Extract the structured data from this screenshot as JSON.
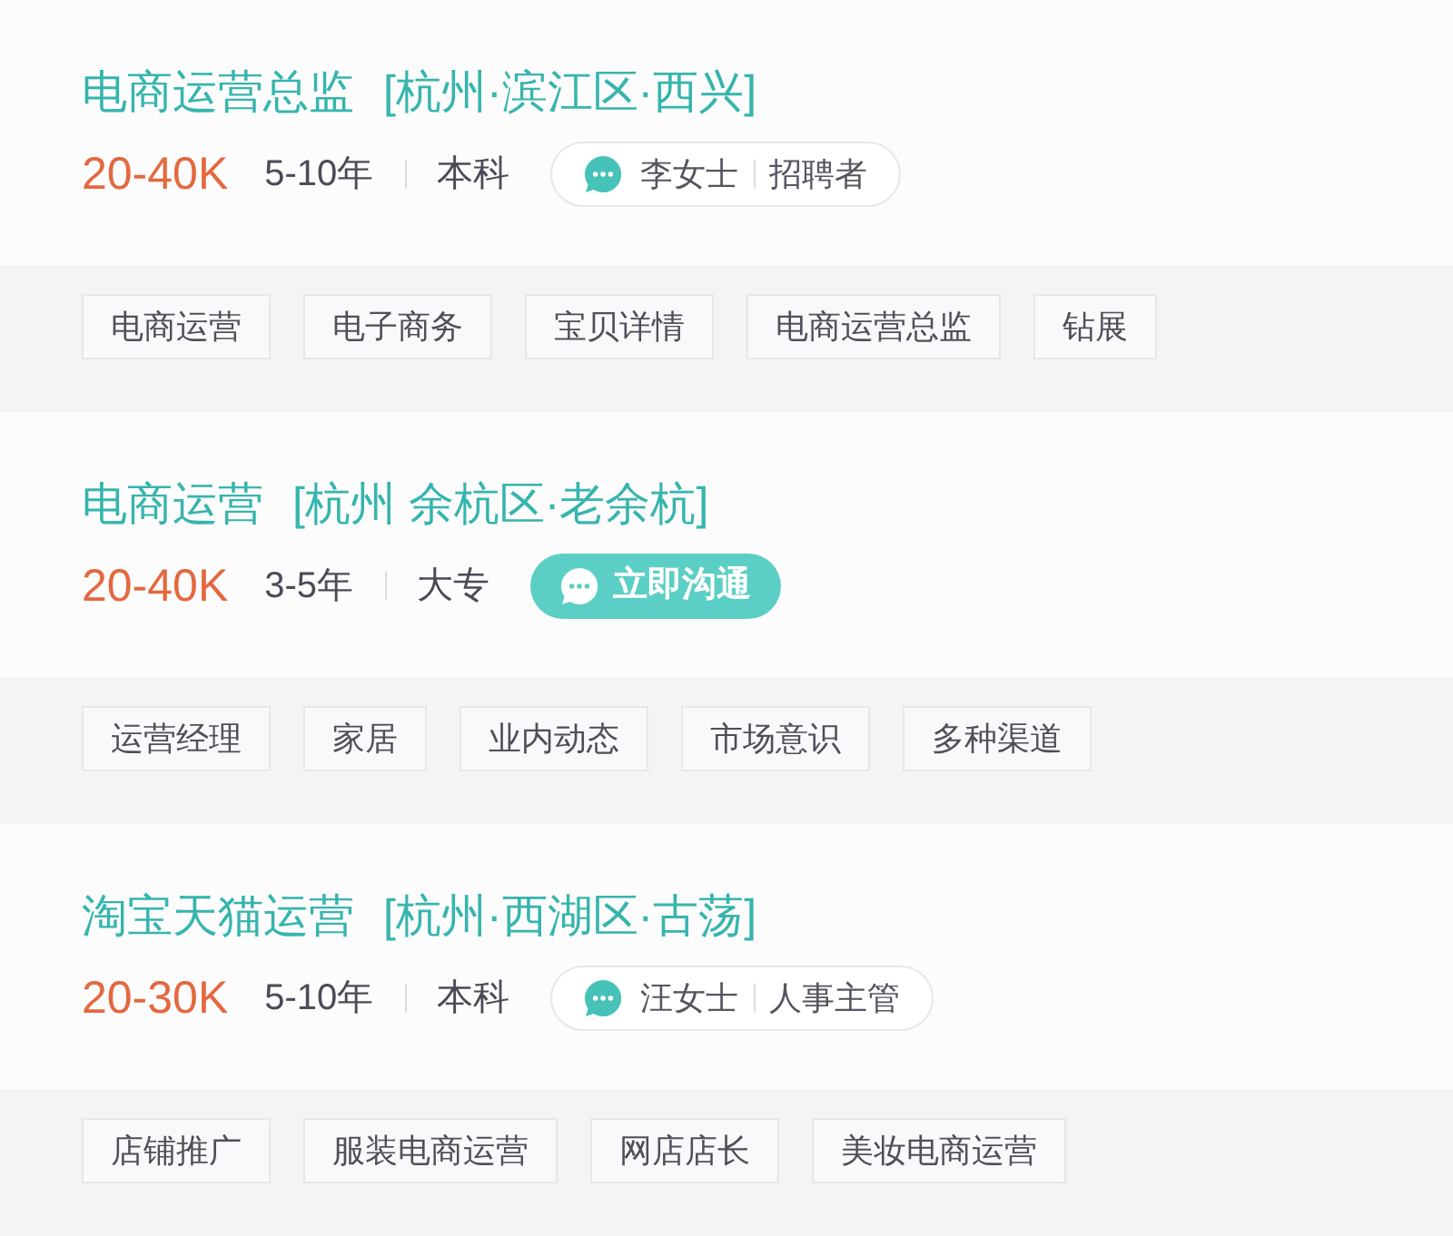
{
  "jobs": [
    {
      "title": "电商运营总监",
      "location": "[杭州·滨江区·西兴]",
      "salary": "20-40K",
      "experience": "5-10年",
      "education": "本科",
      "contact": {
        "kind": "recruiter",
        "name": "李女士",
        "role": "招聘者"
      },
      "tags": [
        "电商运营",
        "电子商务",
        "宝贝详情",
        "电商运营总监",
        "钻展"
      ]
    },
    {
      "title": "电商运营",
      "location": "[杭州 余杭区·老余杭]",
      "salary": "20-40K",
      "experience": "3-5年",
      "education": "大专",
      "contact": {
        "kind": "chat_button",
        "label": "立即沟通"
      },
      "tags": [
        "运营经理",
        "家居",
        "业内动态",
        "市场意识",
        "多种渠道"
      ]
    },
    {
      "title": "淘宝天猫运营",
      "location": "[杭州·西湖区·古荡]",
      "salary": "20-30K",
      "experience": "5-10年",
      "education": "本科",
      "contact": {
        "kind": "recruiter",
        "name": "汪女士",
        "role": "人事主管"
      },
      "tags": [
        "店铺推广",
        "服装电商运营",
        "网店店长",
        "美妆电商运营"
      ]
    }
  ]
}
